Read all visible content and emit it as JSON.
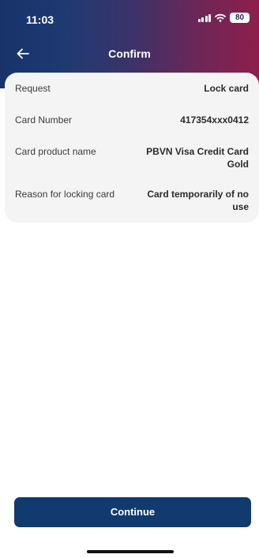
{
  "status_bar": {
    "time": "11:03",
    "battery": "80",
    "icons": [
      "signal-icon",
      "wifi-icon",
      "battery-icon"
    ]
  },
  "nav": {
    "back_icon": "arrow-left-icon",
    "title": "Confirm"
  },
  "details": [
    {
      "label": "Request",
      "value": "Lock card"
    },
    {
      "label": "Card Number",
      "value": "417354xxx0412"
    },
    {
      "label": "Card product name",
      "value": "PBVN Visa Credit Card Gold"
    },
    {
      "label": "Reason for locking card",
      "value": "Card temporarily of no use"
    }
  ],
  "actions": {
    "continue_label": "Continue"
  },
  "colors": {
    "header_gradient_start": "#17336a",
    "header_gradient_end": "#8e1f4c",
    "primary_button": "#113a6e",
    "card_background": "#f4f4f4"
  }
}
